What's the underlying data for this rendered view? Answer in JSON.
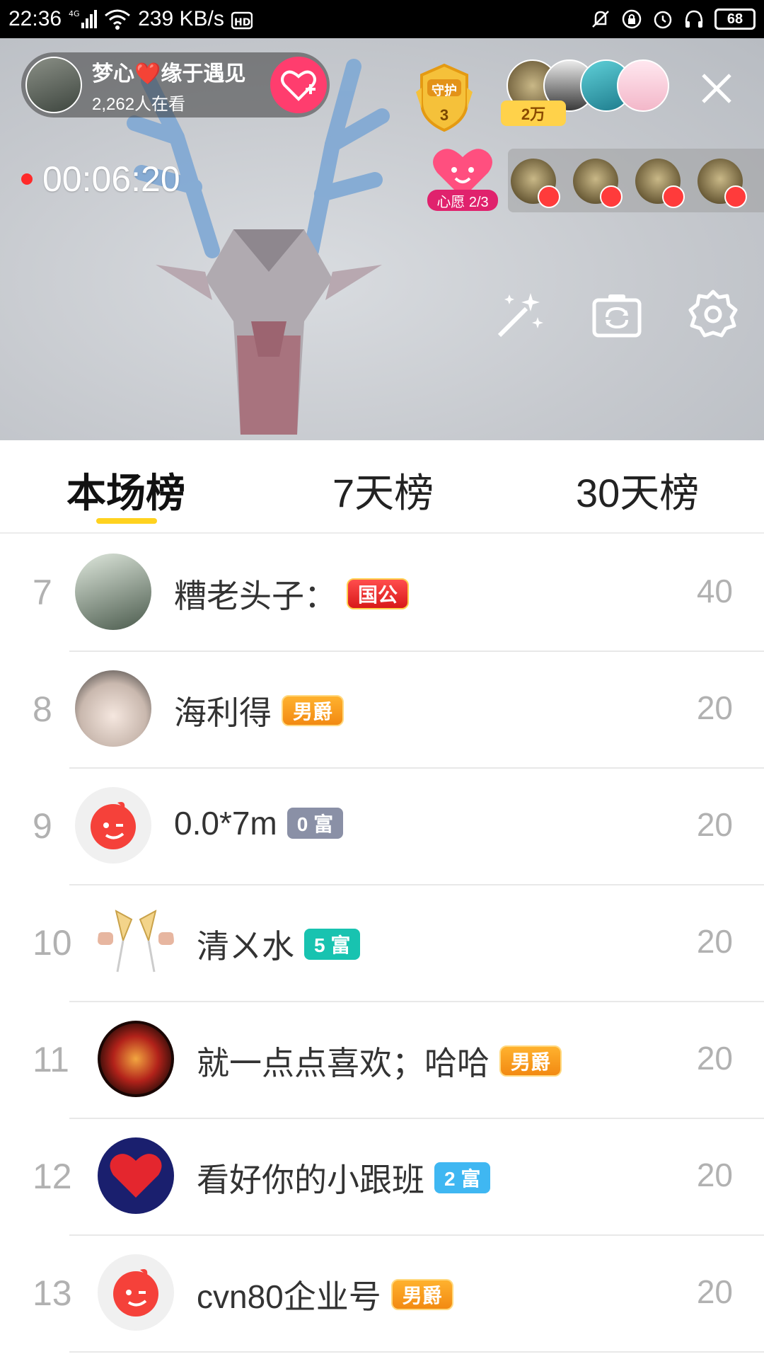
{
  "status_bar": {
    "time": "22:36",
    "network": "4G",
    "speed": "239 KB/s",
    "hd": "HD",
    "battery": "68"
  },
  "live": {
    "host_name": "梦心❤️缘于遇见",
    "viewers": "2,262人在看",
    "guard_label": "守护",
    "guard_count": "3",
    "fans_count": "2万",
    "timer": "00:06:20",
    "wish_label": "心愿 2/3"
  },
  "tabs": [
    {
      "label": "本场榜",
      "active": true
    },
    {
      "label": "7天榜",
      "active": false
    },
    {
      "label": "30天榜",
      "active": false
    }
  ],
  "rankings": [
    {
      "rank": "7",
      "name": "糟老头子：",
      "badge": "国公",
      "badge_type": "guogong",
      "score": "40"
    },
    {
      "rank": "8",
      "name": "海利得",
      "badge": "男爵",
      "badge_type": "noble",
      "score": "20"
    },
    {
      "rank": "9",
      "name": "0.0*7m",
      "badge": "0 富",
      "badge_type": "rich0",
      "score": "20"
    },
    {
      "rank": "10",
      "name": "清ㄨ水",
      "badge": "5 富",
      "badge_type": "rich5",
      "score": "20"
    },
    {
      "rank": "11",
      "name": "就一点点喜欢；哈哈",
      "badge": "男爵",
      "badge_type": "noble",
      "score": "20"
    },
    {
      "rank": "12",
      "name": "看好你的小跟班",
      "badge": "2 富",
      "badge_type": "rich2",
      "score": "20"
    },
    {
      "rank": "13",
      "name": "cvn80企业号",
      "badge": "男爵",
      "badge_type": "noble",
      "score": "20"
    }
  ],
  "colors": {
    "tab_indicator": "#ffd21f",
    "follow": "#ff3d6e",
    "rank_text": "#b1b1b1"
  }
}
